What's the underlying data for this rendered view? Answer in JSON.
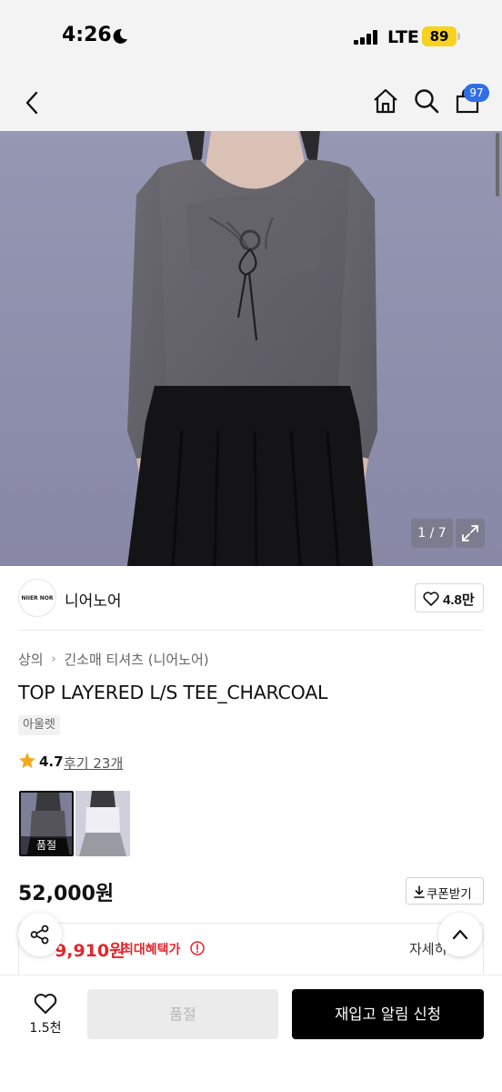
{
  "status_bar": {
    "time": "4:26",
    "network": "LTE",
    "battery": "89",
    "colors": {
      "battery_fill": "#f6d21f"
    }
  },
  "header": {
    "back_icon": "chevron-left-icon",
    "home_icon": "home-icon",
    "search_icon": "search-icon",
    "cart_icon": "shopping-bag-icon",
    "cart_badge": "97",
    "colors": {
      "badge": "#2f6ee4"
    }
  },
  "gallery": {
    "counter": "1 / 7",
    "expand_icon": "expand-icon"
  },
  "brand": {
    "logo_text": "NIIER NOR",
    "name": "니어노어",
    "like_count": "4.8만"
  },
  "product": {
    "breadcrumb": [
      "상의",
      "긴소매 티셔츠 (니어노어)"
    ],
    "title": "TOP LAYERED L/S TEE_CHARCOAL",
    "tag": "아울렛",
    "rating": "4.7",
    "reviews": "후기 23개",
    "swatch_soldout": "품절",
    "price": "52,000원",
    "coupon": "쿠폰받기"
  },
  "benefit": {
    "price": "9,910원",
    "label": "최대혜택가",
    "detail": "자세히",
    "colors": {
      "accent": "#e3262e"
    }
  },
  "bottom_bar": {
    "wish_count": "1.5천",
    "soldout_button": "품절",
    "restock_button": "재입고 알림 신청"
  }
}
